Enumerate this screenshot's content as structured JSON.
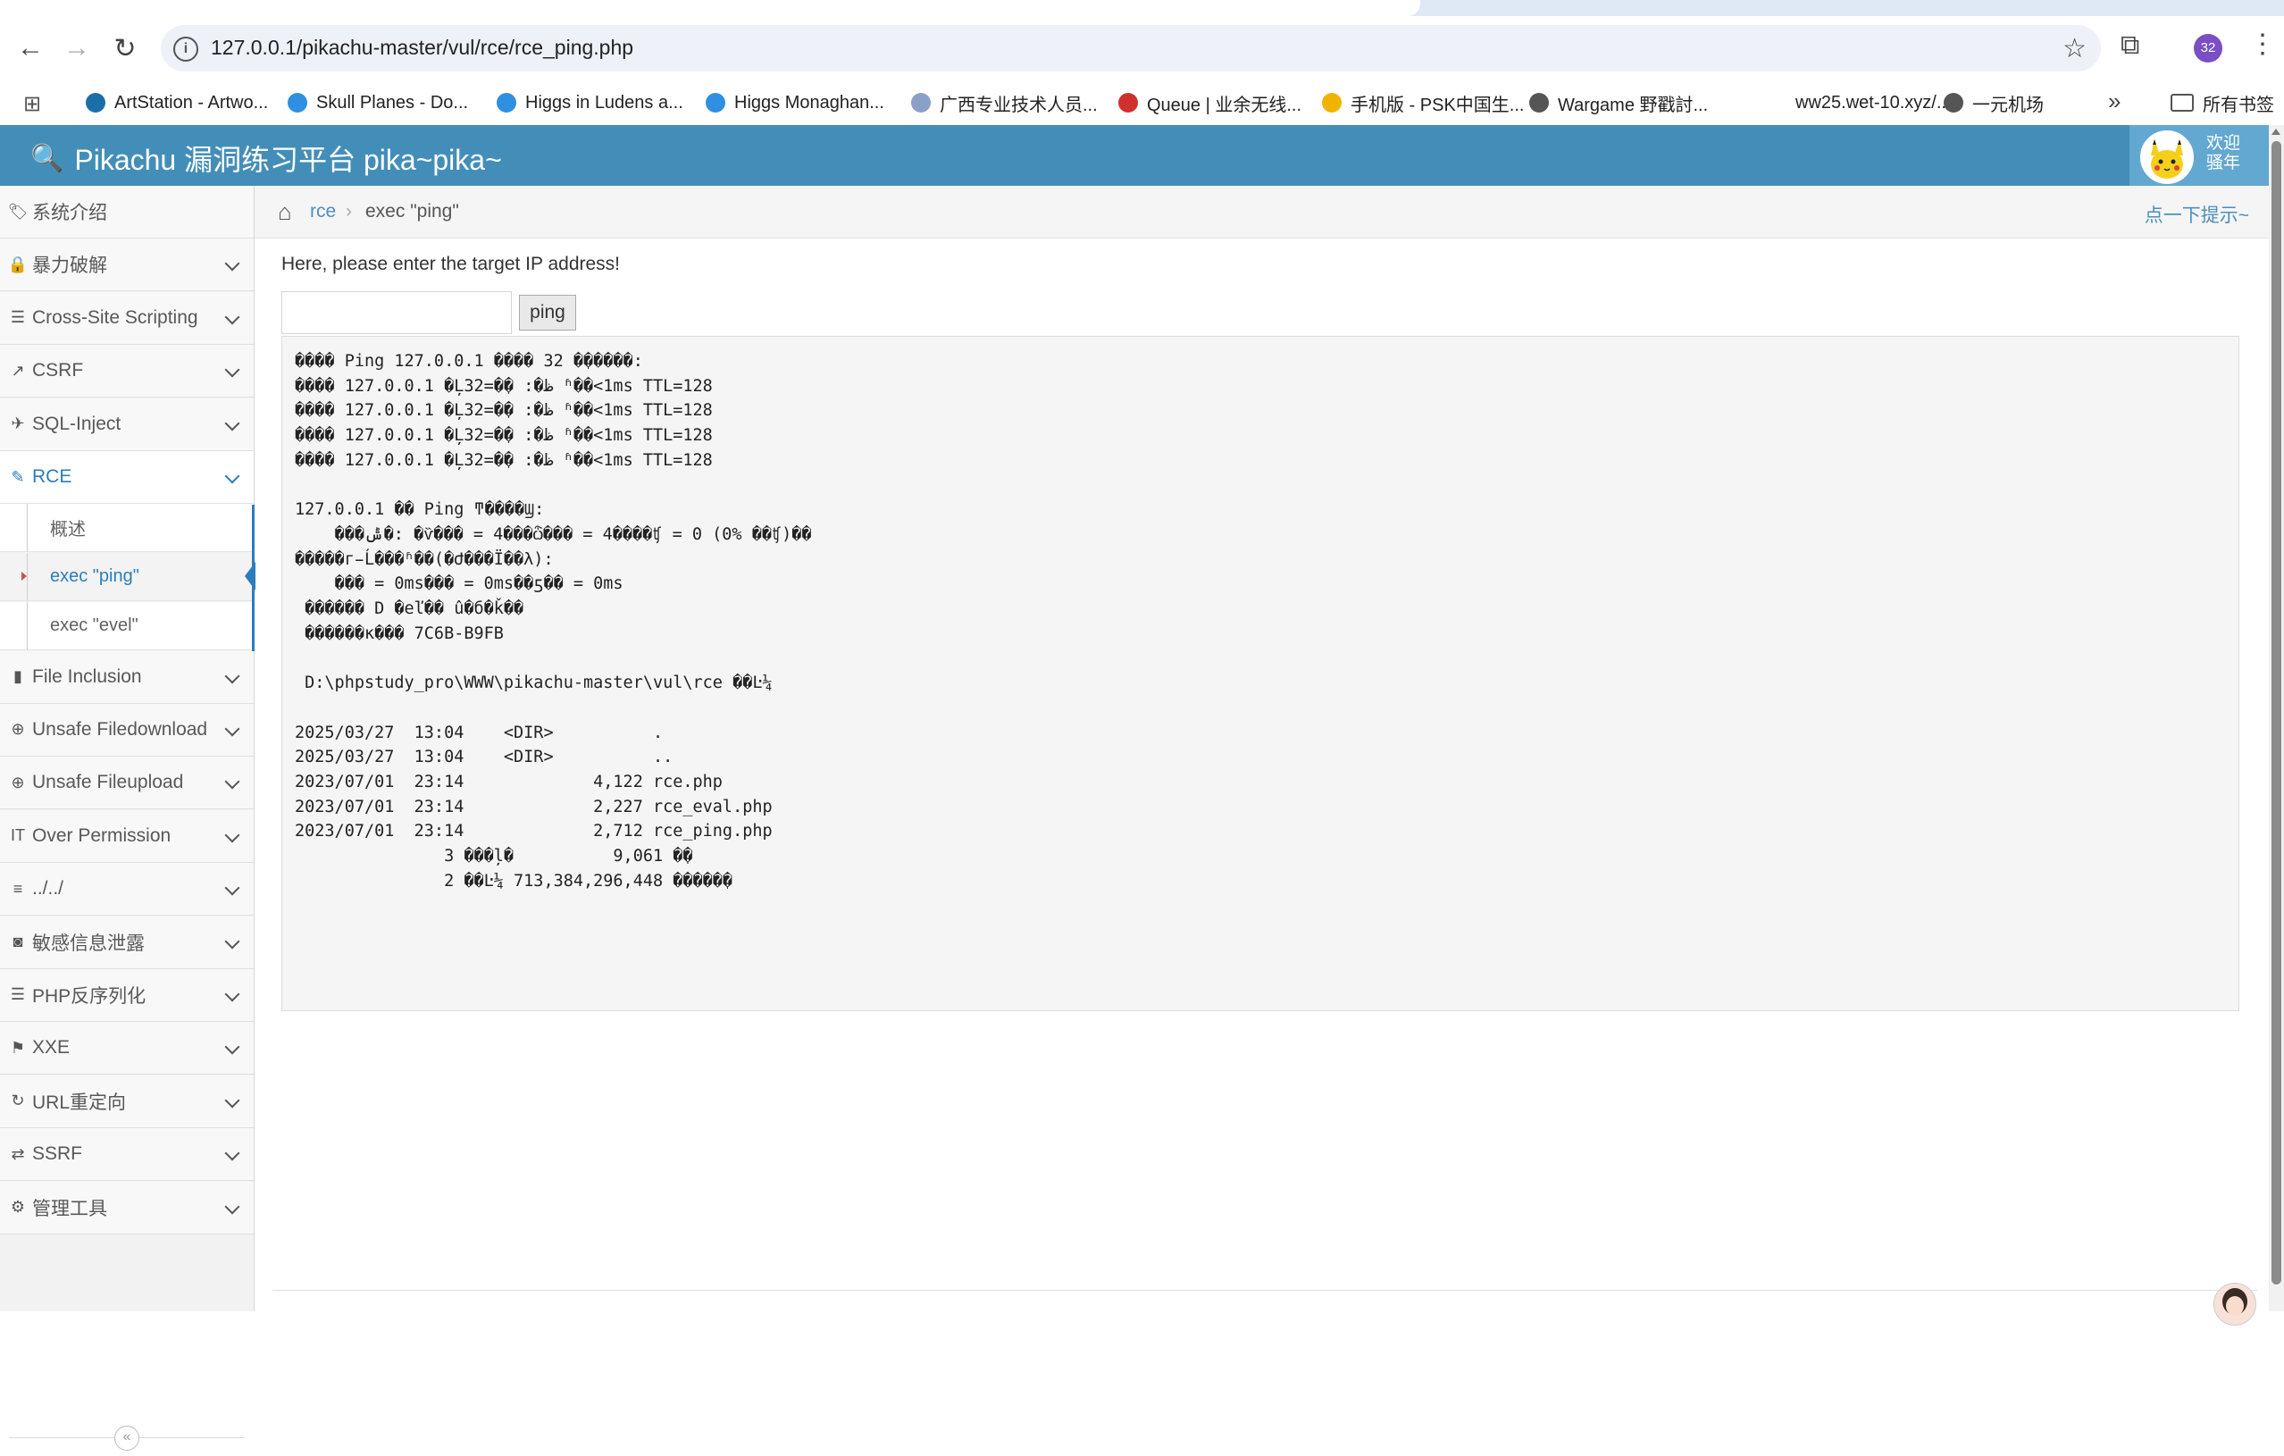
{
  "browser": {
    "url": "127.0.0.1/pikachu-master/vul/rce/rce_ping.php",
    "profile_badge": "32",
    "bookmarks": [
      {
        "label": "ArtStation - Artwo...",
        "color": "#1b6fa8"
      },
      {
        "label": "Skull Planes - Do...",
        "color": "#2f8fe0"
      },
      {
        "label": "Higgs in Ludens a...",
        "color": "#2f8fe0"
      },
      {
        "label": "Higgs Monaghan...",
        "color": "#2f8fe0"
      },
      {
        "label": "广西专业技术人员...",
        "color": "#8aa0c8"
      },
      {
        "label": "Queue | 业余无线...",
        "color": "#d0312d"
      },
      {
        "label": "手机版 - PSK中国生...",
        "color": "#f0b400"
      },
      {
        "label": "Wargame 野戳討...",
        "color": "#555555"
      },
      {
        "label": "ww25.wet-10.xyz/...",
        "color": "#ffffff"
      },
      {
        "label": "一元机场",
        "color": "#555555"
      }
    ],
    "all_bookmarks": "所有书签"
  },
  "app": {
    "title": "Pikachu 漏洞练习平台 pika~pika~",
    "user_welcome": "欢迎",
    "user_name": "骚年",
    "accent": "#438eb9"
  },
  "sidebar": {
    "items": [
      {
        "label": "系统介绍",
        "icon": "tag-icon",
        "glyph": "🏷",
        "chevron": false
      },
      {
        "label": "暴力破解",
        "icon": "lock-icon",
        "glyph": "🔒",
        "chevron": true
      },
      {
        "label": "Cross-Site Scripting",
        "icon": "list-icon",
        "glyph": "☰",
        "chevron": true
      },
      {
        "label": "CSRF",
        "icon": "share-icon",
        "glyph": "↗",
        "chevron": true
      },
      {
        "label": "SQL-Inject",
        "icon": "plane-icon",
        "glyph": "✈",
        "chevron": true
      },
      {
        "label": "RCE",
        "icon": "pencil-icon",
        "glyph": "✎",
        "chevron": true,
        "active": true
      },
      {
        "label": "File Inclusion",
        "icon": "file-icon",
        "glyph": "▮",
        "chevron": true
      },
      {
        "label": "Unsafe Filedownload",
        "icon": "download-icon",
        "glyph": "⊕",
        "chevron": true
      },
      {
        "label": "Unsafe Fileupload",
        "icon": "upload-icon",
        "glyph": "⊕",
        "chevron": true
      },
      {
        "label": "Over Permission",
        "icon": "text-icon",
        "glyph": "IT",
        "chevron": true
      },
      {
        "label": "../../",
        "icon": "align-icon",
        "glyph": "≡",
        "chevron": true
      },
      {
        "label": "敏感信息泄露",
        "icon": "camera-icon",
        "glyph": "◙",
        "chevron": true
      },
      {
        "label": "PHP反序列化",
        "icon": "lines-icon",
        "glyph": "☰",
        "chevron": true
      },
      {
        "label": "XXE",
        "icon": "flag-icon",
        "glyph": "⚑",
        "chevron": true
      },
      {
        "label": "URL重定向",
        "icon": "refresh-icon",
        "glyph": "↻",
        "chevron": true
      },
      {
        "label": "SSRF",
        "icon": "exchange-icon",
        "glyph": "⇄",
        "chevron": true
      },
      {
        "label": "管理工具",
        "icon": "gear-icon",
        "glyph": "⚙",
        "chevron": true
      }
    ],
    "rce_subitems": [
      {
        "label": "概述"
      },
      {
        "label": "exec \"ping\"",
        "active": true
      },
      {
        "label": "exec \"evel\""
      }
    ]
  },
  "breadcrumb": {
    "parent": "rce",
    "current": "exec \"ping\"",
    "hint": "点一下提示~"
  },
  "form": {
    "instruction": "Here, please enter the target IP address!",
    "input_value": "",
    "button_label": "ping"
  },
  "output": {
    "text": "���� Ping 127.0.0.1 ���� 32 �ֽ�����:\n���� 127.0.0.1 �Ļظ�: �ֽ�=32 ʱ��<1ms TTL=128\n���� 127.0.0.1 �Ļظ�: �ֽ�=32 ʱ��<1ms TTL=128\n���� 127.0.0.1 �Ļظ�: �ֽ�=32 ʱ��<1ms TTL=128\n���� 127.0.0.1 �Ļظ�: �ֽ�=32 ʱ��<1ms TTL=128\n\n127.0.0.1 �� Ping ͳ����Ϣ:\n    ���ݰ�: �ѷ��� = 4���ѽ��� = 4����ʧ = 0 (0% ��ʧ)��\n�����г̵Ĺ���ʱ��(�Ժ���Ϊ��λ):\n    ��� = 0ms��� = 0ms��ƽ�� = 0ms\n ������ D �еľ�� û�б�ǩ��\n ������к��� 7C6B-B9FB\n\n D:\\phpstudy_pro\\WWW\\pikachu-master\\vul\\rce ��Ŀ¼\n\n2025/03/27  13:04    <DIR>          .\n2025/03/27  13:04    <DIR>          ..\n2023/07/01  23:14             4,122 rce.php\n2023/07/01  23:14             2,227 rce_eval.php\n2023/07/01  23:14             2,712 rce_ping.php\n               3 ���ļ�          9,061 �ֽ�\n               2 ��Ŀ¼ 713,384,296,448 �����ֽ�"
  }
}
